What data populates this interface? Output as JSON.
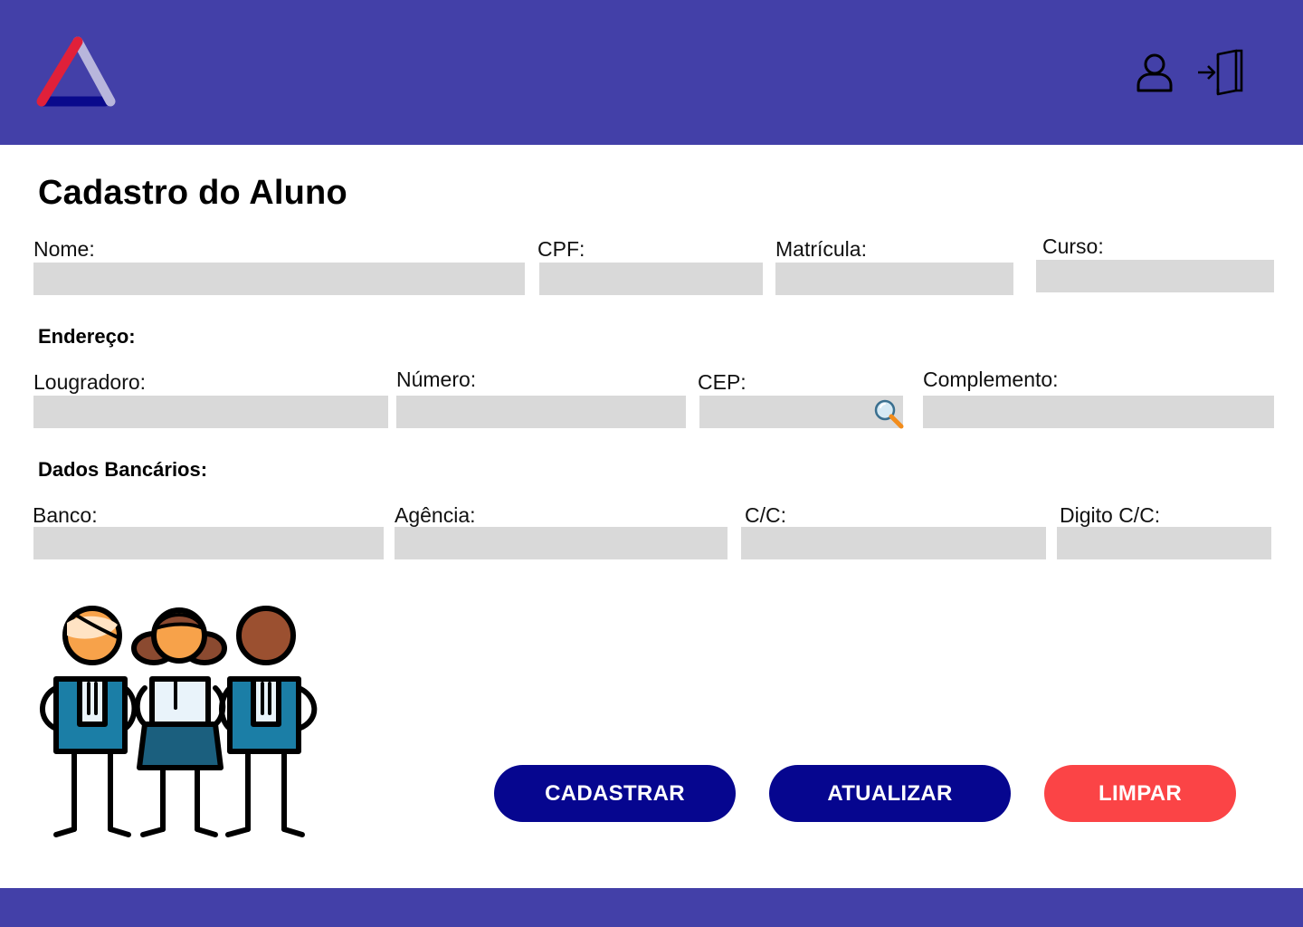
{
  "header": {
    "logo_icon": "triangle-logo",
    "user_icon": "user-icon",
    "logout_icon": "logout-icon",
    "background_color": "#4340a8"
  },
  "page": {
    "title": "Cadastro do Aluno"
  },
  "student": {
    "nome_label": "Nome:",
    "nome_value": "",
    "cpf_label": "CPF:",
    "cpf_value": "",
    "matricula_label": "Matrícula:",
    "matricula_value": "",
    "curso_label": "Curso:",
    "curso_value": ""
  },
  "address": {
    "section_title": "Endereço:",
    "logradouro_label": "Lougradoro:",
    "logradouro_value": "",
    "numero_label": "Número:",
    "numero_value": "",
    "cep_label": "CEP:",
    "cep_value": "",
    "cep_search_icon": "search-icon",
    "complemento_label": "Complemento:",
    "complemento_value": ""
  },
  "bank": {
    "section_title": "Dados Bancários:",
    "banco_label": "Banco:",
    "banco_value": "",
    "agencia_label": "Agência:",
    "agencia_value": "",
    "cc_label": "C/C:",
    "cc_value": "",
    "digito_label": "Digito C/C:",
    "digito_value": ""
  },
  "actions": {
    "cadastrar_label": "CADASTRAR",
    "atualizar_label": "ATUALIZAR",
    "limpar_label": "LIMPAR",
    "primary_color": "#06068f",
    "danger_color": "#fb4446"
  },
  "illustration": {
    "icon": "students-group-illustration"
  },
  "colors": {
    "brand": "#4340a8",
    "field_bg": "#d9d9d9"
  }
}
